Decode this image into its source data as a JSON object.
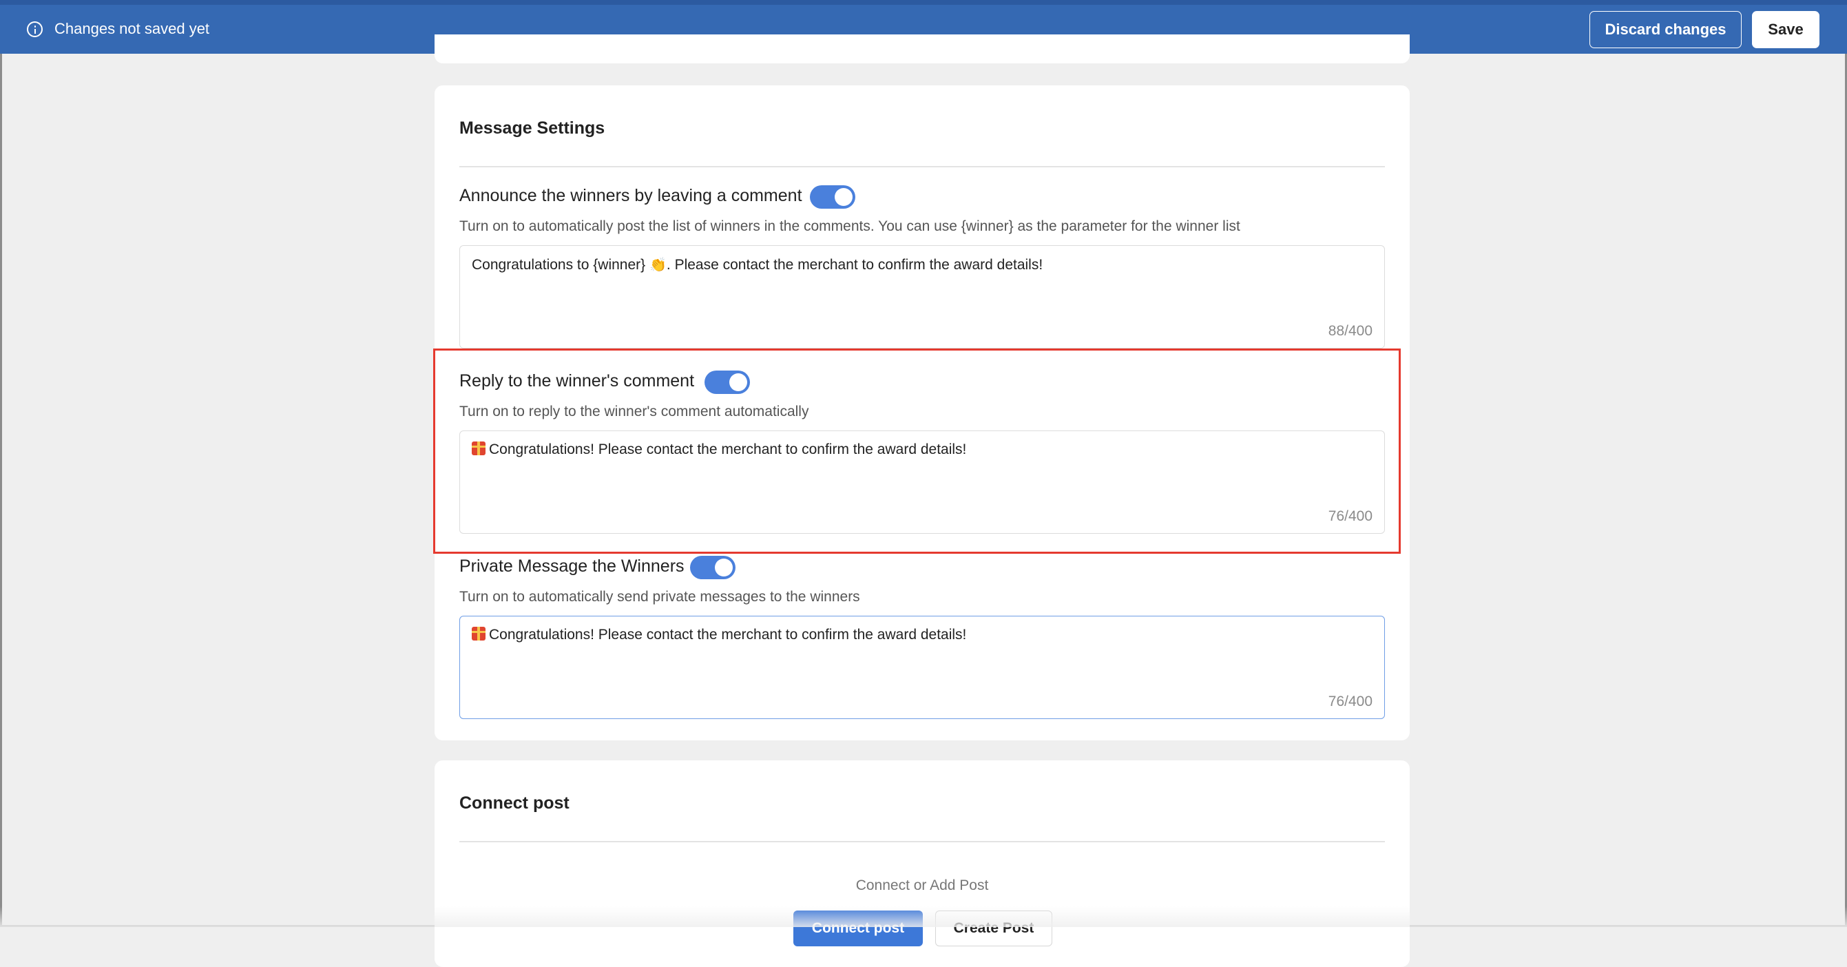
{
  "savebar": {
    "status": "Changes not saved yet",
    "discard_label": "Discard changes",
    "save_label": "Save",
    "icon": "info-icon"
  },
  "message_settings": {
    "title": "Message Settings",
    "announce": {
      "label": "Announce the winners by leaving a comment",
      "enabled": true,
      "help": "Turn on to automatically post the list of winners in the comments. You can use {winner} as the parameter for the winner list",
      "text_before": "Congratulations to {winner} ",
      "emoji": "👏",
      "text_after": ". Please contact the merchant to confirm the award details!",
      "count": "88/400"
    },
    "reply": {
      "label": "Reply to the winner's comment",
      "enabled": true,
      "help": "Turn on to reply to the winner's comment automatically",
      "text": "Congratulations! Please contact the merchant to confirm the award details!",
      "icon": "gift-icon",
      "count": "76/400"
    },
    "private": {
      "label": "Private Message the Winners",
      "enabled": true,
      "help": "Turn on to automatically send private messages to the winners",
      "text": "Congratulations! Please contact the merchant to confirm the award details!",
      "icon": "gift-icon",
      "count": "76/400"
    }
  },
  "connect_post": {
    "title": "Connect post",
    "hint": "Connect or Add Post",
    "connect_label": "Connect post",
    "create_label": "Create Post"
  },
  "colors": {
    "bar": "#3569b3",
    "toggle_on": "#4a80dc",
    "highlight": "#e53a2f"
  }
}
